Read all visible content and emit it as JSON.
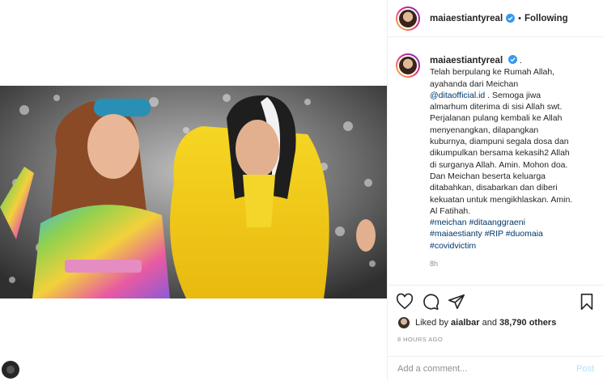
{
  "post": {
    "username": "maiaestiantyreal",
    "follow_status": "Following",
    "dot": "•",
    "caption_dot": "."
  },
  "caption": {
    "lines": [
      "Telah berpulang ke Rumah Allah,",
      "ayahanda dari Meichan",
      "@ditaofficial.id . Semoga jiwa",
      "almarhum diterima di sisi Allah swt.",
      "Perjalanan pulang kembali ke Allah",
      "menyenangkan, dilapangkan",
      "kuburnya, diampuni segala dosa dan",
      "dikumpulkan bersama kekasih2 Allah",
      "di surganya Allah. Amin. Mohon doa.",
      "Dan Meichan beserta keluarga",
      "ditabahkan, disabarkan dan diberi",
      "kekuatan untuk mengikhlaskan. Amin.",
      "Al Fatihah."
    ],
    "mention": "@ditaofficial.id",
    "hashtags_line1": "#meichan #ditaanggraeni",
    "hashtags_line2": "#maiaestianty #RIP #duomaia",
    "hashtags_line3": "#covidvictim",
    "ago": "8h"
  },
  "likes": {
    "prefix": "Liked by",
    "liker": "aialbar",
    "and": "and",
    "count": "38,790 others"
  },
  "timestamp": "8 HOURS AGO",
  "comment": {
    "placeholder": "Add a comment...",
    "post_label": "Post"
  },
  "icons": {
    "like": "heart-icon",
    "comment": "comment-icon",
    "share": "share-icon",
    "save": "bookmark-icon",
    "verified": "verified-badge-icon"
  },
  "colors": {
    "verified": "#3897f0",
    "link": "#00376b",
    "post_button": "#b2dffc"
  }
}
